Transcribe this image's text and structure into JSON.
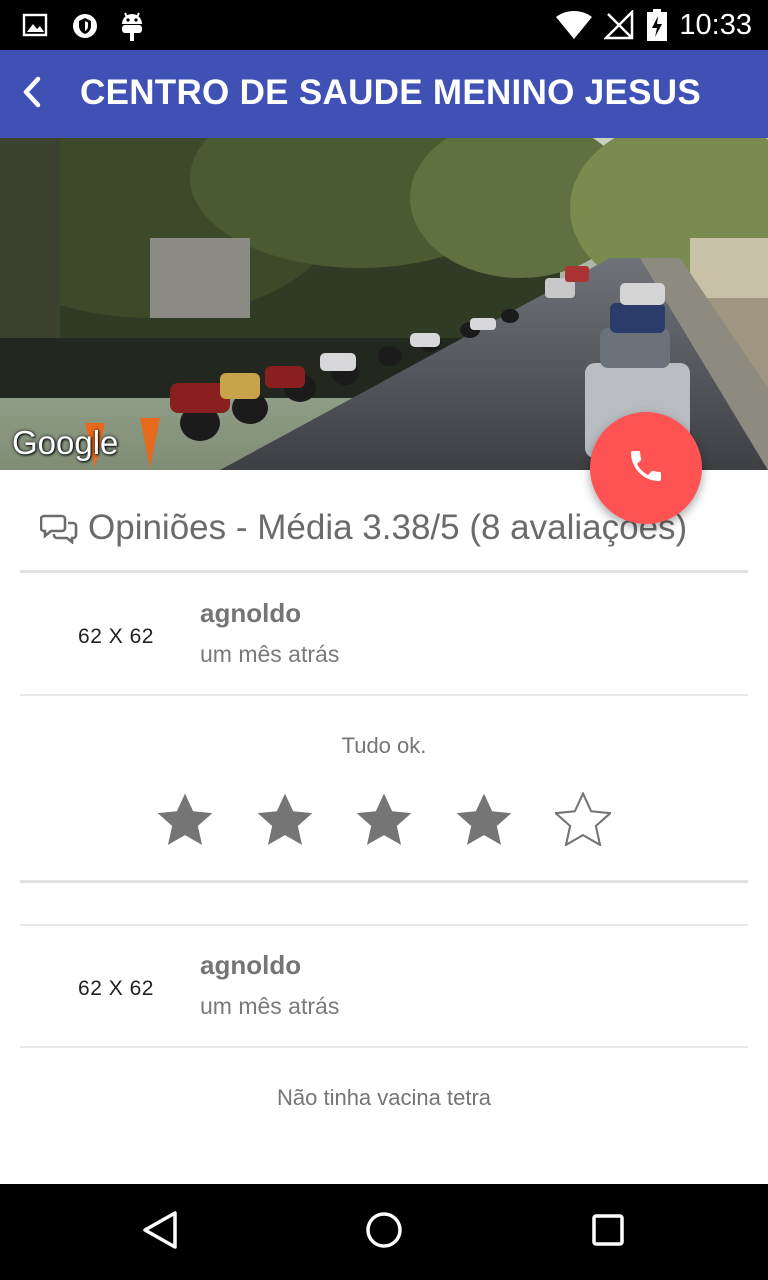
{
  "status_bar": {
    "time": "10:33",
    "left_icons": [
      "image-icon",
      "shield-icon",
      "android-icon"
    ],
    "right_icons": [
      "wifi-icon",
      "no-signal-icon",
      "battery-charging-icon"
    ]
  },
  "toolbar": {
    "title": "CENTRO DE SAUDE MENINO JESUS",
    "back_icon": "chevron-left-icon",
    "color": "#3f51b5"
  },
  "hero": {
    "watermark": "Google"
  },
  "fab": {
    "icon": "phone-icon",
    "color": "#ff5252"
  },
  "opinions": {
    "header": "Opiniões - Média 3.38/5 (8 avaliações)",
    "icon": "chat-bubbles-icon"
  },
  "reviews": [
    {
      "avatar_placeholder": "62 X 62",
      "author": "agnoldo",
      "time_ago": "um mês atrás",
      "text": "Tudo ok.",
      "rating": 4,
      "max_rating": 5
    },
    {
      "avatar_placeholder": "62 X 62",
      "author": "agnoldo",
      "time_ago": "um mês atrás",
      "text": "Não tinha vacina tetra"
    }
  ],
  "nav_bar": {
    "icons": [
      "back-triangle-icon",
      "home-circle-icon",
      "recents-square-icon"
    ]
  }
}
